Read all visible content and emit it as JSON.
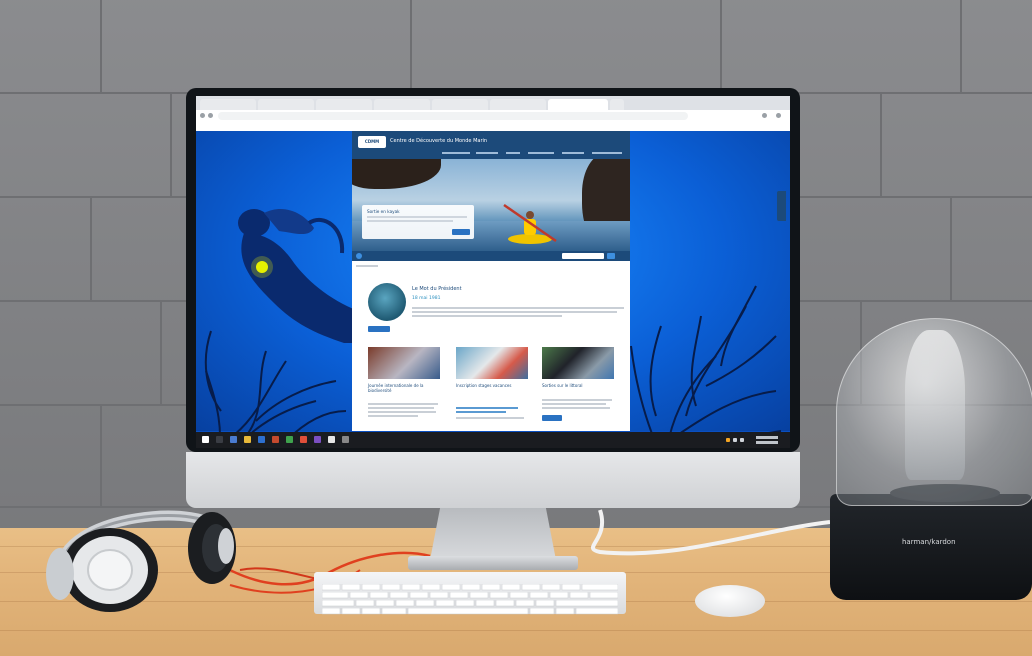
{
  "colors": {
    "wall": "#86878a",
    "desk": "#e2b47a",
    "screen_ocean": "#0b5fd6",
    "site_header": "#1c4a7a",
    "accent_button": "#2a72c2",
    "taskbar": "#1a1c20",
    "speaker_base": "#14171a",
    "headphone_cable": "#e0401f"
  },
  "browser": {
    "tabs": [
      "",
      "",
      "",
      "",
      "",
      "",
      "",
      "",
      ""
    ],
    "url": "",
    "bookmarks": [
      "",
      "",
      "",
      "",
      "",
      "",
      "",
      "",
      "",
      "",
      ""
    ]
  },
  "site": {
    "title": "Centre de Découverte du Monde Marin",
    "logo": "CDMM",
    "nav": [
      "",
      "",
      "",
      "",
      "",
      ""
    ],
    "hero": {
      "box_title": "Sortie en kayak",
      "box_button": ""
    },
    "feature": {
      "title": "Le Mot du Président",
      "date": "18 mai 1981"
    },
    "cards": [
      {
        "title": "Journée internationale de la biodiversité"
      },
      {
        "title": "Inscription stages vacances"
      },
      {
        "title": "Sorties sur le littoral"
      }
    ]
  },
  "speaker": {
    "brand": "harman/kardon"
  },
  "icons": [
    "search-icon",
    "monitor-icon",
    "headphones-icon",
    "keyboard-icon",
    "mouse-icon",
    "speaker-icon",
    "windows-start-icon"
  ]
}
